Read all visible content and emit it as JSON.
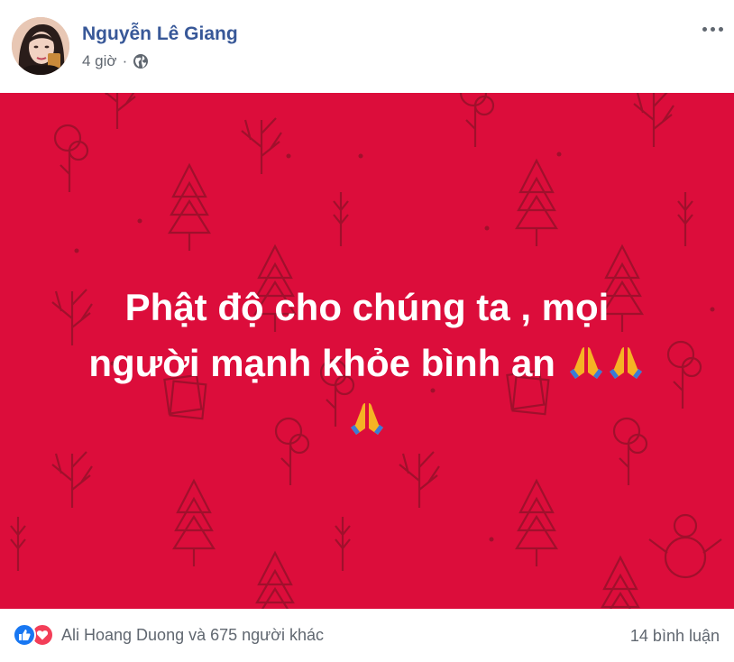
{
  "post": {
    "author": "Nguyễn Lê Giang",
    "time": "4 giờ",
    "separator": "·",
    "privacy_icon": "globe-icon",
    "menu_icon": "more-options-icon",
    "background_color": "#dc0d3b",
    "text_lines": [
      "Phật độ cho chúng ta , mọi",
      "người mạnh khỏe bình an"
    ],
    "emoji": "folded-hands"
  },
  "footer": {
    "reaction_icons": [
      "like-icon",
      "love-icon"
    ],
    "likers": "Ali Hoang Duong và 675 người khác",
    "comments": "14 bình luận"
  },
  "colors": {
    "author_link": "#385898",
    "muted": "#606770",
    "like": "#1877f2",
    "love": "#f33e58"
  }
}
